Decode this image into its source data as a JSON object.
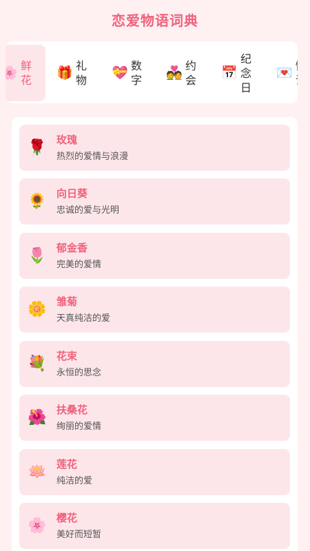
{
  "app": {
    "title": "恋爱物语词典"
  },
  "categories": [
    {
      "id": "flower",
      "label": "鲜花",
      "icon": "🌸",
      "icon_name": "cherry-blossom-icon",
      "active": true
    },
    {
      "id": "gift",
      "label": "礼物",
      "icon": "🎁",
      "icon_name": "gift-icon",
      "active": false
    },
    {
      "id": "number",
      "label": "数字",
      "icon": "💝",
      "icon_name": "heart-ribbon-icon",
      "active": false
    },
    {
      "id": "date",
      "label": "约会",
      "icon": "💑",
      "icon_name": "couple-icon",
      "active": false
    },
    {
      "id": "anniversary",
      "label": "纪念日",
      "icon": "📅",
      "icon_name": "calendar-icon",
      "active": false
    },
    {
      "id": "loveletter",
      "label": "情话",
      "icon": "💌",
      "icon_name": "love-letter-icon",
      "active": false
    }
  ],
  "items": [
    {
      "name": "玫瑰",
      "desc": "热烈的爱情与浪漫",
      "icon": "🌹",
      "icon_name": "rose-icon"
    },
    {
      "name": "向日葵",
      "desc": "忠诚的爱与光明",
      "icon": "🌻",
      "icon_name": "sunflower-icon"
    },
    {
      "name": "郁金香",
      "desc": "完美的爱情",
      "icon": "🌷",
      "icon_name": "tulip-icon"
    },
    {
      "name": "雏菊",
      "desc": "天真纯洁的爱",
      "icon": "🌼",
      "icon_name": "daisy-icon"
    },
    {
      "name": "花束",
      "desc": "永恒的思念",
      "icon": "💐",
      "icon_name": "bouquet-icon"
    },
    {
      "name": "扶桑花",
      "desc": "绚丽的爱情",
      "icon": "🌺",
      "icon_name": "hibiscus-icon"
    },
    {
      "name": "莲花",
      "desc": "纯洁的爱",
      "icon": "🪷",
      "icon_name": "lotus-icon"
    },
    {
      "name": "樱花",
      "desc": "美好而短暂",
      "icon": "🌸",
      "icon_name": "cherry-blossom-icon"
    }
  ],
  "colors": {
    "accent": "#f0627c",
    "background": "#fff0f2",
    "item_background": "#fde6ea",
    "active_tab_background": "#fde6ea"
  }
}
